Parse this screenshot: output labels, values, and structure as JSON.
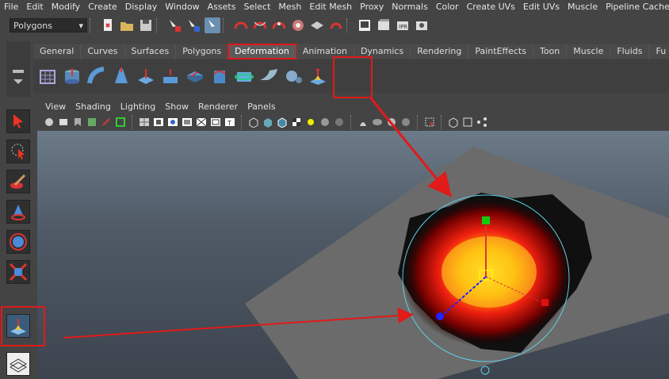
{
  "menubar": [
    "File",
    "Edit",
    "Modify",
    "Create",
    "Display",
    "Window",
    "Assets",
    "Select",
    "Mesh",
    "Edit Mesh",
    "Proxy",
    "Normals",
    "Color",
    "Create UVs",
    "Edit UVs",
    "Muscle",
    "Pipeline Cache"
  ],
  "status_line": {
    "mode": "Polygons"
  },
  "shelf": {
    "tabs": [
      "General",
      "Curves",
      "Surfaces",
      "Polygons",
      "Deformation",
      "Animation",
      "Dynamics",
      "Rendering",
      "PaintEffects",
      "Toon",
      "Muscle",
      "Fluids",
      "Fu"
    ],
    "active_tab": "Deformation",
    "icons": [
      "lattice-icon",
      "cluster-icon",
      "bend-icon",
      "flare-icon",
      "sine-icon",
      "squash-icon",
      "twist-icon",
      "wave-icon",
      "wrap-icon",
      "wire-icon",
      "sculpt-icon",
      "soft-modification-icon"
    ]
  },
  "panel": {
    "menus": [
      "View",
      "Shading",
      "Lighting",
      "Show",
      "Renderer",
      "Panels"
    ]
  },
  "accent": "#e11a1a",
  "viewport_colors": {
    "plane": "#6f6f6f",
    "gizmo_circle": "#5fd0e6"
  }
}
